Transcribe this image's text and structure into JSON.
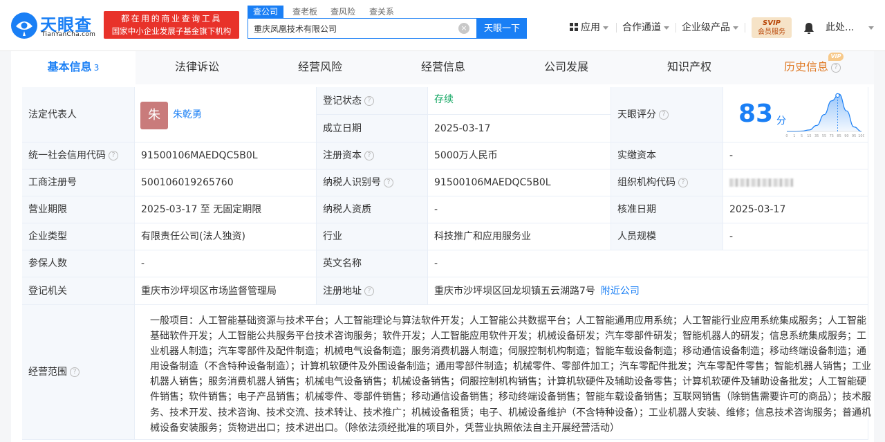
{
  "header": {
    "logo_cn": "天眼查",
    "logo_en": "TianYanCha.com",
    "banner_line1": "都在用的商业查询工具",
    "banner_line2": "国家中小企业发展子基金旗下机构",
    "search_tabs": [
      "查公司",
      "查老板",
      "查风险",
      "查关系"
    ],
    "search_value": "重庆凤凰技术有限公司",
    "search_button": "天眼一下",
    "nav": [
      "应用",
      "合作通道",
      "企业级产品"
    ],
    "svip_line1": "SVIP",
    "svip_line2": "会员服务",
    "user_name": "此处..."
  },
  "tabs": [
    {
      "label": "基本信息",
      "sup": "3"
    },
    {
      "label": "法律诉讼"
    },
    {
      "label": "经营风险"
    },
    {
      "label": "经营信息"
    },
    {
      "label": "公司发展"
    },
    {
      "label": "知识产权"
    },
    {
      "label": "历史信息",
      "badge": "VIP"
    }
  ],
  "info": {
    "legal_rep_label": "法定代表人",
    "legal_rep_avatar": "朱",
    "legal_rep_name": "朱乾勇",
    "reg_status_label": "登记状态",
    "reg_status_value": "存续",
    "found_date_label": "成立日期",
    "found_date_value": "2025-03-17",
    "score_label": "天眼评分",
    "score_value": "83",
    "score_unit": "分",
    "credit_code_label": "统一社会信用代码",
    "credit_code_value": "91500106MAEDQC5B0L",
    "reg_capital_label": "注册资本",
    "reg_capital_value": "5000万人民币",
    "paid_capital_label": "实缴资本",
    "paid_capital_value": "-",
    "biz_reg_no_label": "工商注册号",
    "biz_reg_no_value": "500106019265760",
    "taxpayer_id_label": "纳税人识别号",
    "taxpayer_id_value": "91500106MAEDQC5B0L",
    "org_code_label": "组织机构代码",
    "term_label": "营业期限",
    "term_value": "2025-03-17 至 无固定期限",
    "taxpayer_qual_label": "纳税人资质",
    "taxpayer_qual_value": "-",
    "approve_date_label": "核准日期",
    "approve_date_value": "2025-03-17",
    "company_type_label": "企业类型",
    "company_type_value": "有限责任公司(法人独资)",
    "industry_label": "行业",
    "industry_value": "科技推广和应用服务业",
    "staff_size_label": "人员规模",
    "staff_size_value": "-",
    "insured_label": "参保人数",
    "insured_value": "-",
    "english_name_label": "英文名称",
    "english_name_value": "-",
    "authority_label": "登记机关",
    "authority_value": "重庆市沙坪坝区市场监督管理局",
    "address_label": "注册地址",
    "address_value": "重庆市沙坪坝区回龙坝镇五云湖路7号",
    "nearby_link": "附近公司",
    "scope_label": "经营范围",
    "scope_value": "一般项目：人工智能基础资源与技术平台；人工智能理论与算法软件开发；人工智能公共数据平台；人工智能通用应用系统；人工智能行业应用系统集成服务；人工智能基础软件开发；人工智能公共服务平台技术咨询服务；软件开发；人工智能应用软件开发；机械设备研发；汽车零部件研发；智能机器人的研发；信息系统集成服务；工业机器人制造；汽车零部件及配件制造；机械电气设备制造；服务消费机器人制造；伺服控制机构制造；智能车载设备制造；移动通信设备制造；移动终端设备制造；通用设备制造（不含特种设备制造）；计算机软硬件及外围设备制造；通用零部件制造；机械零件、零部件加工；汽车零配件批发；汽车零配件零售；智能机器人销售；工业机器人销售；服务消费机器人销售；机械电气设备销售；机械设备销售；伺服控制机构销售；计算机软硬件及辅助设备零售；计算机软硬件及辅助设备批发；人工智能硬件销售；软件销售；电子产品销售；机械零件、零部件销售；移动通信设备销售；移动终端设备销售；智能车载设备销售；互联网销售（除销售需要许可的商品）；技术服务、技术开发、技术咨询、技术交流、技术转让、技术推广；机械设备租赁；电子、机械设备维护（不含特种设备）；工业机器人安装、维修；信息技术咨询服务；普通机械设备安装服务；货物进出口；技术进出口。（除依法须经批准的项目外，凭营业执照依法自主开展经营活动）"
  },
  "chart_data": {
    "type": "area",
    "x": [
      0,
      1,
      5,
      15,
      35,
      55,
      75,
      85,
      90,
      95,
      100
    ],
    "y": [
      0,
      0,
      0.01,
      0.04,
      0.16,
      0.45,
      0.82,
      1.0,
      0.55,
      0.12,
      0
    ],
    "xticks": [
      "0",
      "1",
      "5",
      "15",
      "35",
      "55",
      "75",
      "85",
      "90",
      "95",
      "100"
    ],
    "marker_x": 83,
    "color": "#1a7ff5"
  }
}
